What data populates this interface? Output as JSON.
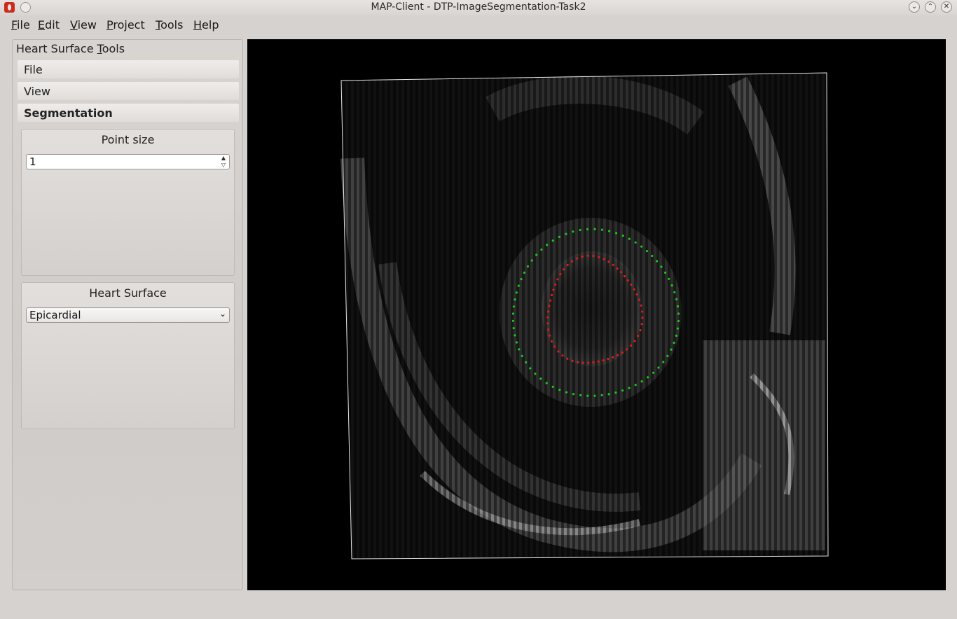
{
  "window": {
    "title": "MAP-Client - DTP-ImageSegmentation-Task2",
    "minimize_label": "⌄",
    "maximize_label": "⌃",
    "close_label": "✕"
  },
  "menubar": {
    "file": {
      "mnemonic": "F",
      "rest": "ile"
    },
    "edit": {
      "mnemonic": "E",
      "rest": "dit"
    },
    "view": {
      "mnemonic": "V",
      "rest": "iew"
    },
    "project": {
      "mnemonic": "P",
      "rest": "roject"
    },
    "tools": {
      "mnemonic": "T",
      "rest": "ools"
    },
    "help": {
      "mnemonic": "H",
      "rest": "elp"
    }
  },
  "tool_panel": {
    "title_prefix": "Heart Surface ",
    "title_mnemonic": "T",
    "title_suffix": "ools",
    "sections": [
      "File",
      "View",
      "Segmentation"
    ],
    "active_section": "Segmentation",
    "point_size": {
      "label": "Point size",
      "value": "1"
    },
    "heart_surface": {
      "label": "Heart Surface",
      "selected": "Epicardial"
    }
  },
  "viewport": {
    "contours": [
      {
        "surface": "epicardial",
        "color": "#1fc41f"
      },
      {
        "surface": "endocardial",
        "color": "#dd1a1a"
      }
    ]
  }
}
